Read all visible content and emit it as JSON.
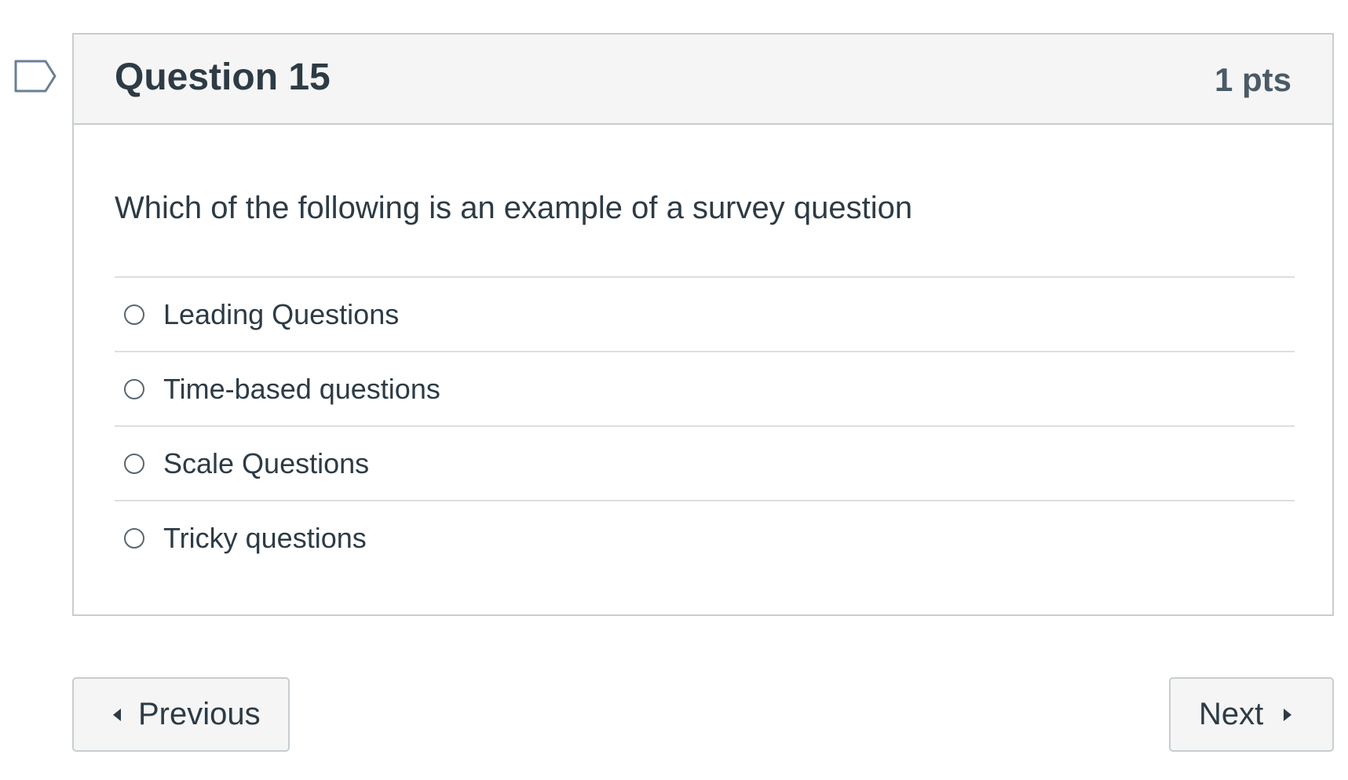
{
  "question": {
    "title": "Question 15",
    "points": "1 pts",
    "text": "Which of the following is an example of a survey question",
    "answers": [
      {
        "label": "Leading Questions",
        "selected": false
      },
      {
        "label": "Time-based questions",
        "selected": false
      },
      {
        "label": "Scale Questions",
        "selected": false
      },
      {
        "label": "Tricky questions",
        "selected": false
      }
    ]
  },
  "navigation": {
    "previous_label": "Previous",
    "next_label": "Next"
  },
  "icons": {
    "flag": "flag-bookmark-icon",
    "previous": "caret-left-icon",
    "next": "caret-right-icon"
  },
  "colors": {
    "header_bg": "#f5f5f5",
    "border": "#c7cdd1",
    "text": "#2d3b45",
    "flag_stroke": "#6b7f94"
  }
}
